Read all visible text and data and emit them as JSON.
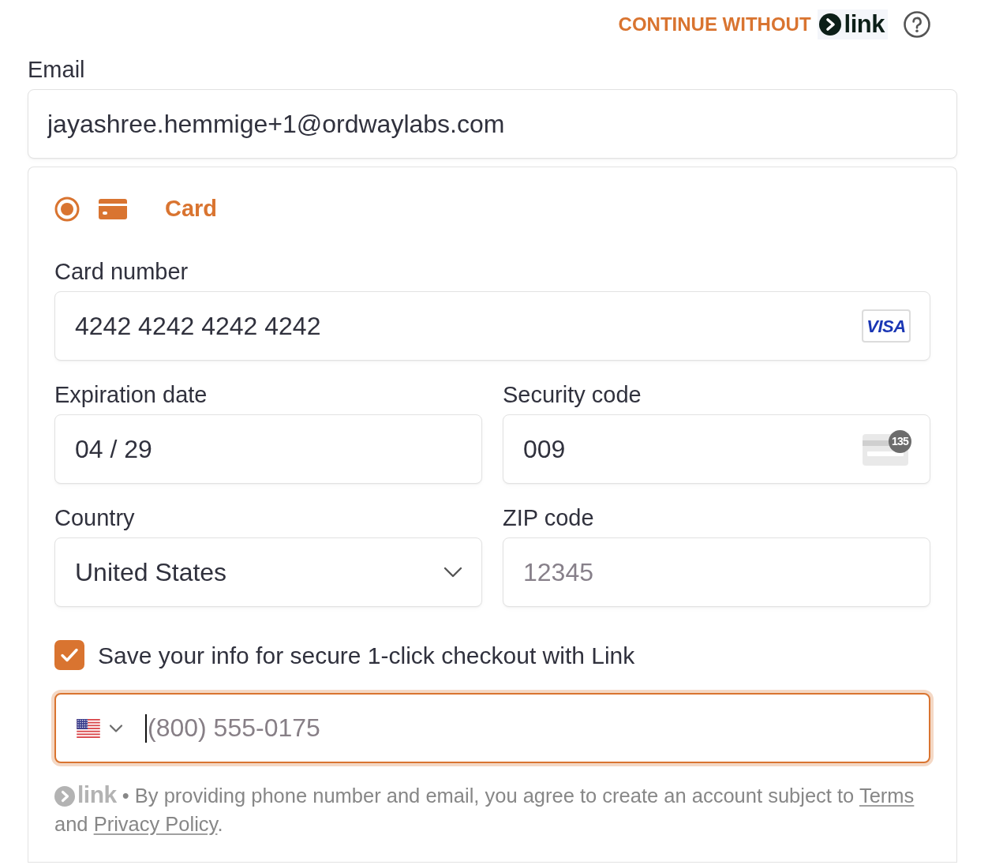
{
  "header": {
    "continue_label": "CONTINUE WITHOUT",
    "brand": "link"
  },
  "email": {
    "label": "Email",
    "value": "jayashree.hemmige+1@ordwaylabs.com"
  },
  "payment_methods": [
    {
      "label": "Card",
      "selected": true
    }
  ],
  "card_fields": [
    [
      {
        "kind": "card_number",
        "label": "Card number",
        "value": "4242 4242 4242 4242",
        "brand": "VISA"
      }
    ],
    [
      {
        "kind": "text",
        "label": "Expiration date",
        "value": "04 / 29"
      },
      {
        "kind": "security_code",
        "label": "Security code",
        "value": "009",
        "hint": "135"
      }
    ],
    [
      {
        "kind": "select",
        "label": "Country",
        "value": "United States"
      },
      {
        "kind": "text",
        "label": "ZIP code",
        "placeholder": "12345"
      }
    ]
  ],
  "save_info": {
    "label": "Save your info for secure 1-click checkout with Link",
    "checked": true
  },
  "phone": {
    "placeholder": "(800) 555-0175",
    "focused": true
  },
  "legal": {
    "brand": "link",
    "separator": "•",
    "segments": [
      {
        "kind": "text",
        "text": "By providing phone number and email, you agree to create an account subject to "
      },
      {
        "kind": "link",
        "text": "Terms"
      },
      {
        "kind": "text",
        "text": " and "
      },
      {
        "kind": "link",
        "text": "Privacy Policy"
      },
      {
        "kind": "text",
        "text": "."
      }
    ]
  }
}
